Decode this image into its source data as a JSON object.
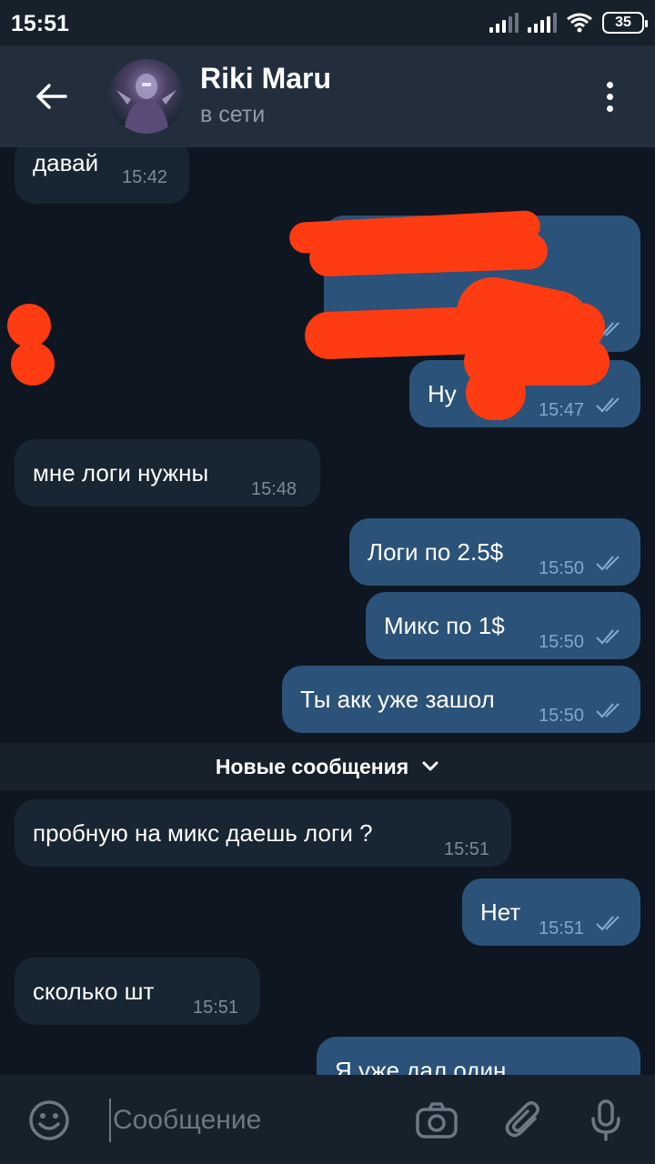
{
  "status_bar": {
    "time": "15:51",
    "battery": "35"
  },
  "header": {
    "name": "Riki Maru",
    "status": "в сети"
  },
  "messages": [
    {
      "dir": "in",
      "text": "давай",
      "time": "15:42"
    },
    {
      "dir": "out",
      "text": "",
      "time": "",
      "redacted": true
    },
    {
      "dir": "out",
      "text": "Ну",
      "text_tail": "?",
      "time": "15:47",
      "redacted": true
    },
    {
      "dir": "in",
      "text": "мне логи нужны",
      "time": "15:48"
    },
    {
      "dir": "out",
      "text": "Логи по 2.5$",
      "time": "15:50"
    },
    {
      "dir": "out",
      "text": "Микс по 1$",
      "time": "15:50"
    },
    {
      "dir": "out",
      "text": "Ты акк уже зашол",
      "time": "15:50"
    },
    {
      "dir": "in",
      "text": "пробную на микс даешь логи  ?",
      "time": "15:51"
    },
    {
      "dir": "out",
      "text": "Нет",
      "time": "15:51"
    },
    {
      "dir": "in",
      "text": "сколько шт",
      "time": "15:51"
    },
    {
      "dir": "out",
      "text": "Я уже дал один",
      "time": ""
    }
  ],
  "divider": {
    "label": "Новые сообщения"
  },
  "input": {
    "placeholder": "Сообщение"
  },
  "colors": {
    "background": "#0e1621",
    "header": "#232e3c",
    "incoming_bubble": "#182533",
    "outgoing_bubble": "#2b5278",
    "redaction": "#ff3b12"
  }
}
